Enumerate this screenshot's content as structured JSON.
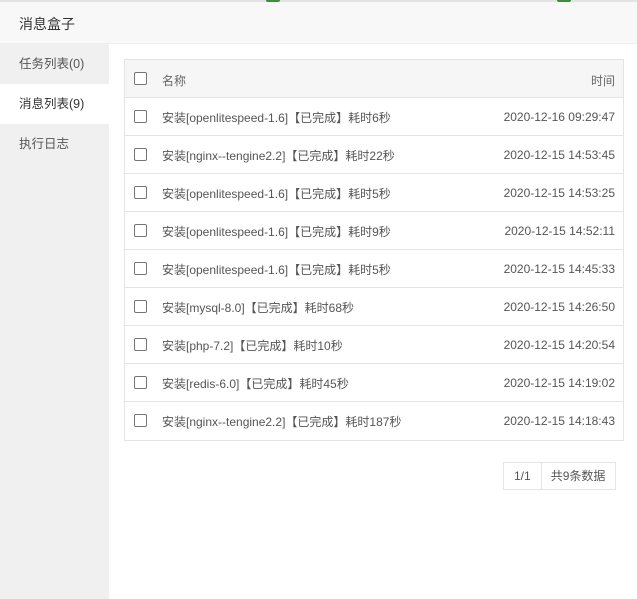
{
  "window": {
    "title": "消息盒子"
  },
  "sidebar": {
    "items": [
      {
        "label": "任务列表(0)"
      },
      {
        "label": "消息列表(9)"
      },
      {
        "label": "执行日志"
      }
    ]
  },
  "table": {
    "headers": {
      "name": "名称",
      "time": "时间"
    },
    "rows": [
      {
        "name": "安装[openlitespeed-1.6]【已完成】耗时6秒",
        "time": "2020-12-16 09:29:47"
      },
      {
        "name": "安装[nginx--tengine2.2]【已完成】耗时22秒",
        "time": "2020-12-15 14:53:45"
      },
      {
        "name": "安装[openlitespeed-1.6]【已完成】耗时5秒",
        "time": "2020-12-15 14:53:25"
      },
      {
        "name": "安装[openlitespeed-1.6]【已完成】耗时9秒",
        "time": "2020-12-15 14:52:11"
      },
      {
        "name": "安装[openlitespeed-1.6]【已完成】耗时5秒",
        "time": "2020-12-15 14:45:33"
      },
      {
        "name": "安装[mysql-8.0]【已完成】耗时68秒",
        "time": "2020-12-15 14:26:50"
      },
      {
        "name": "安装[php-7.2]【已完成】耗时10秒",
        "time": "2020-12-15 14:20:54"
      },
      {
        "name": "安装[redis-6.0]【已完成】耗时45秒",
        "time": "2020-12-15 14:19:02"
      },
      {
        "name": "安装[nginx--tengine2.2]【已完成】耗时187秒",
        "time": "2020-12-15 14:18:43"
      }
    ]
  },
  "pager": {
    "page": "1/1",
    "total": "共9条数据"
  }
}
